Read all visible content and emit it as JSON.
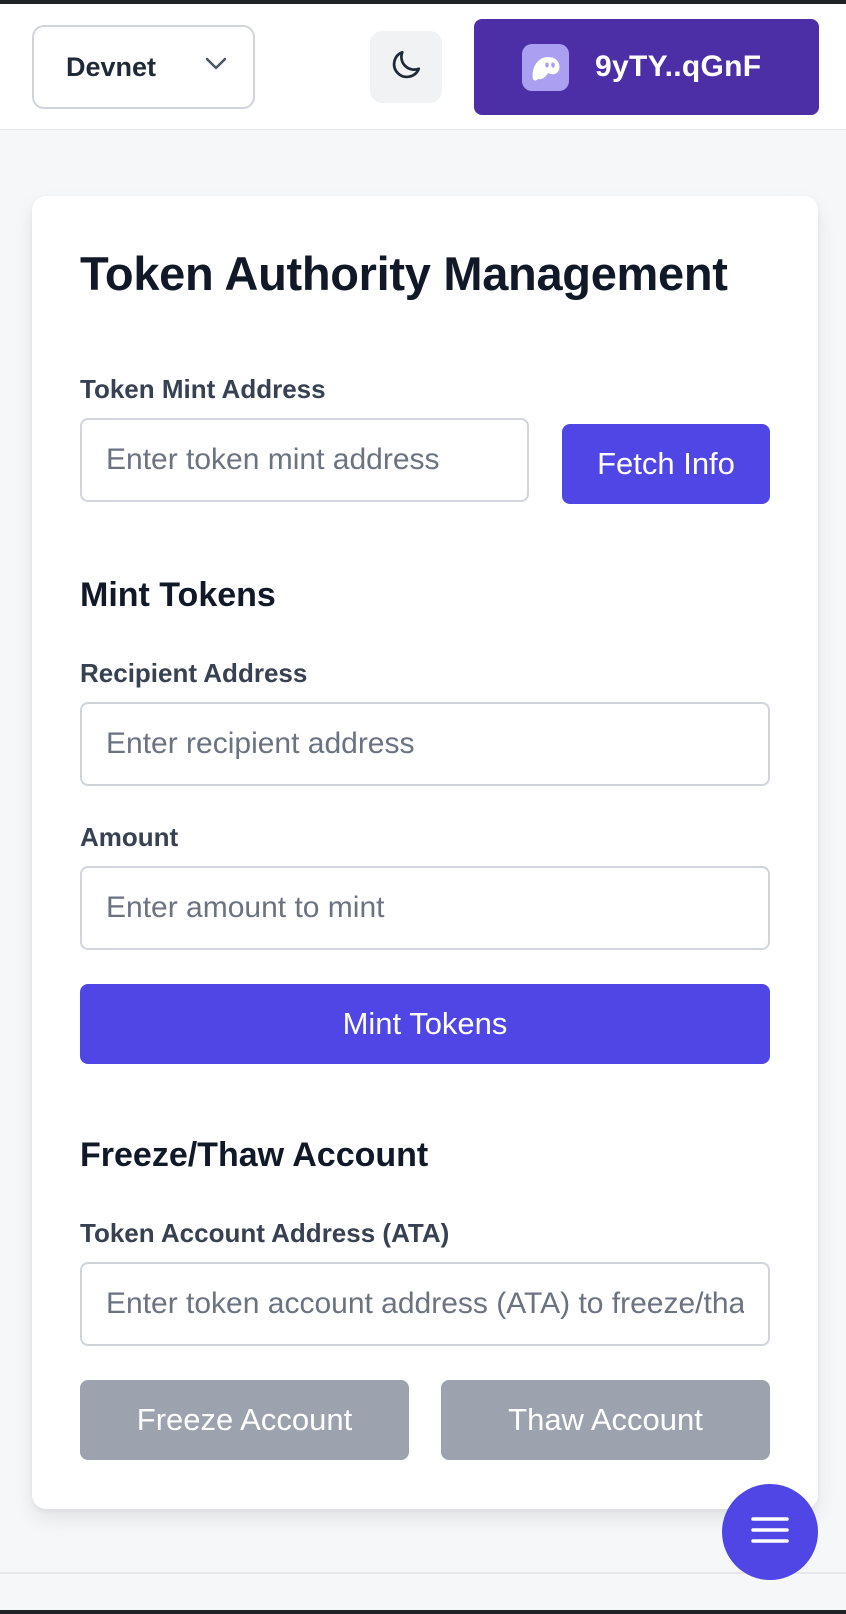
{
  "header": {
    "network": {
      "selected": "Devnet",
      "icon": "chevron-down-icon"
    },
    "theme_toggle": {
      "icon": "moon-icon"
    },
    "wallet": {
      "address": "9yTY..qGnF",
      "icon": "phantom-ghost-icon",
      "color": "#4c2fa6"
    }
  },
  "card": {
    "title": "Token Authority Management",
    "mint_address": {
      "label": "Token Mint Address",
      "placeholder": "Enter token mint address",
      "value": "",
      "button": "Fetch Info"
    },
    "mint_tokens": {
      "title": "Mint Tokens",
      "recipient": {
        "label": "Recipient Address",
        "placeholder": "Enter recipient address",
        "value": ""
      },
      "amount": {
        "label": "Amount",
        "placeholder": "Enter amount to mint",
        "value": ""
      },
      "button": "Mint Tokens"
    },
    "freeze_thaw": {
      "title": "Freeze/Thaw Account",
      "ata": {
        "label": "Token Account Address (ATA)",
        "placeholder": "Enter token account address (ATA) to freeze/thaw",
        "value": ""
      },
      "freeze_button": "Freeze Account",
      "thaw_button": "Thaw Account"
    }
  },
  "fab": {
    "icon": "menu-icon"
  },
  "colors": {
    "primary": "#4f46e5",
    "disabled": "#9ca3af",
    "wallet": "#4c2fa6",
    "background": "#f6f7f9"
  }
}
